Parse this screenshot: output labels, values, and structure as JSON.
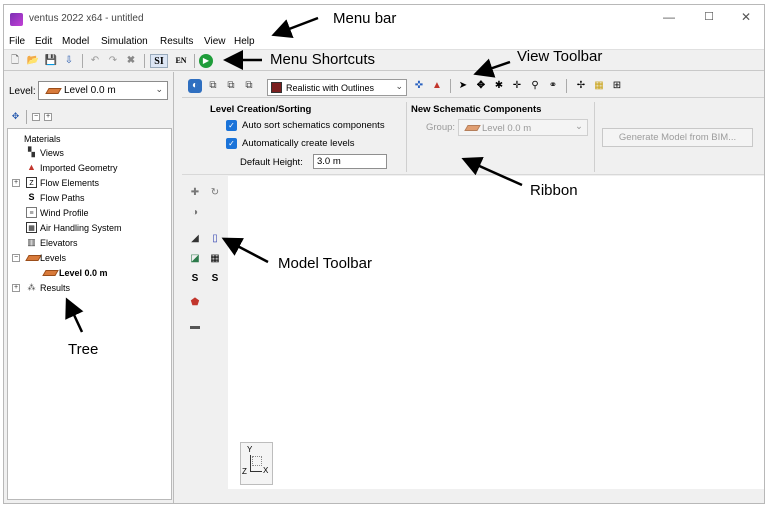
{
  "window": {
    "title": "ventus 2022 x64 - untitled",
    "minimize": "—",
    "maximize": "☐",
    "close": "✕"
  },
  "menu": {
    "items": [
      "File",
      "Edit",
      "Model",
      "Simulation",
      "Results",
      "View",
      "Help"
    ]
  },
  "shortcuts": {
    "si": "SI",
    "en": "EN"
  },
  "level_panel": {
    "label": "Level:",
    "selected": "Level 0.0 m"
  },
  "tree": {
    "items": [
      "Materials",
      "Views",
      "Imported Geometry",
      "Flow Elements",
      "Flow Paths",
      "Wind Profile",
      "Air Handling System",
      "Elevators",
      "Levels",
      "Level 0.0 m",
      "Results"
    ]
  },
  "view_toolbar": {
    "render_mode": "Realistic with Outlines"
  },
  "ribbon": {
    "level_section": {
      "title": "Level Creation/Sorting",
      "auto_sort": "Auto sort schematics components",
      "auto_create": "Automatically create levels",
      "default_height_label": "Default Height:",
      "default_height_value": "3.0 m"
    },
    "schematic_section": {
      "title": "New Schematic Components",
      "group_label": "Group:",
      "group_value": "Level 0.0 m"
    },
    "generate_button": "Generate Model from BIM..."
  },
  "axis": {
    "y": "Y",
    "z": "Z",
    "x": "X"
  },
  "annotations": {
    "menu_bar": "Menu bar",
    "menu_shortcuts": "Menu Shortcuts",
    "view_toolbar": "View Toolbar",
    "ribbon": "Ribbon",
    "model_toolbar": "Model Toolbar",
    "tree": "Tree"
  }
}
